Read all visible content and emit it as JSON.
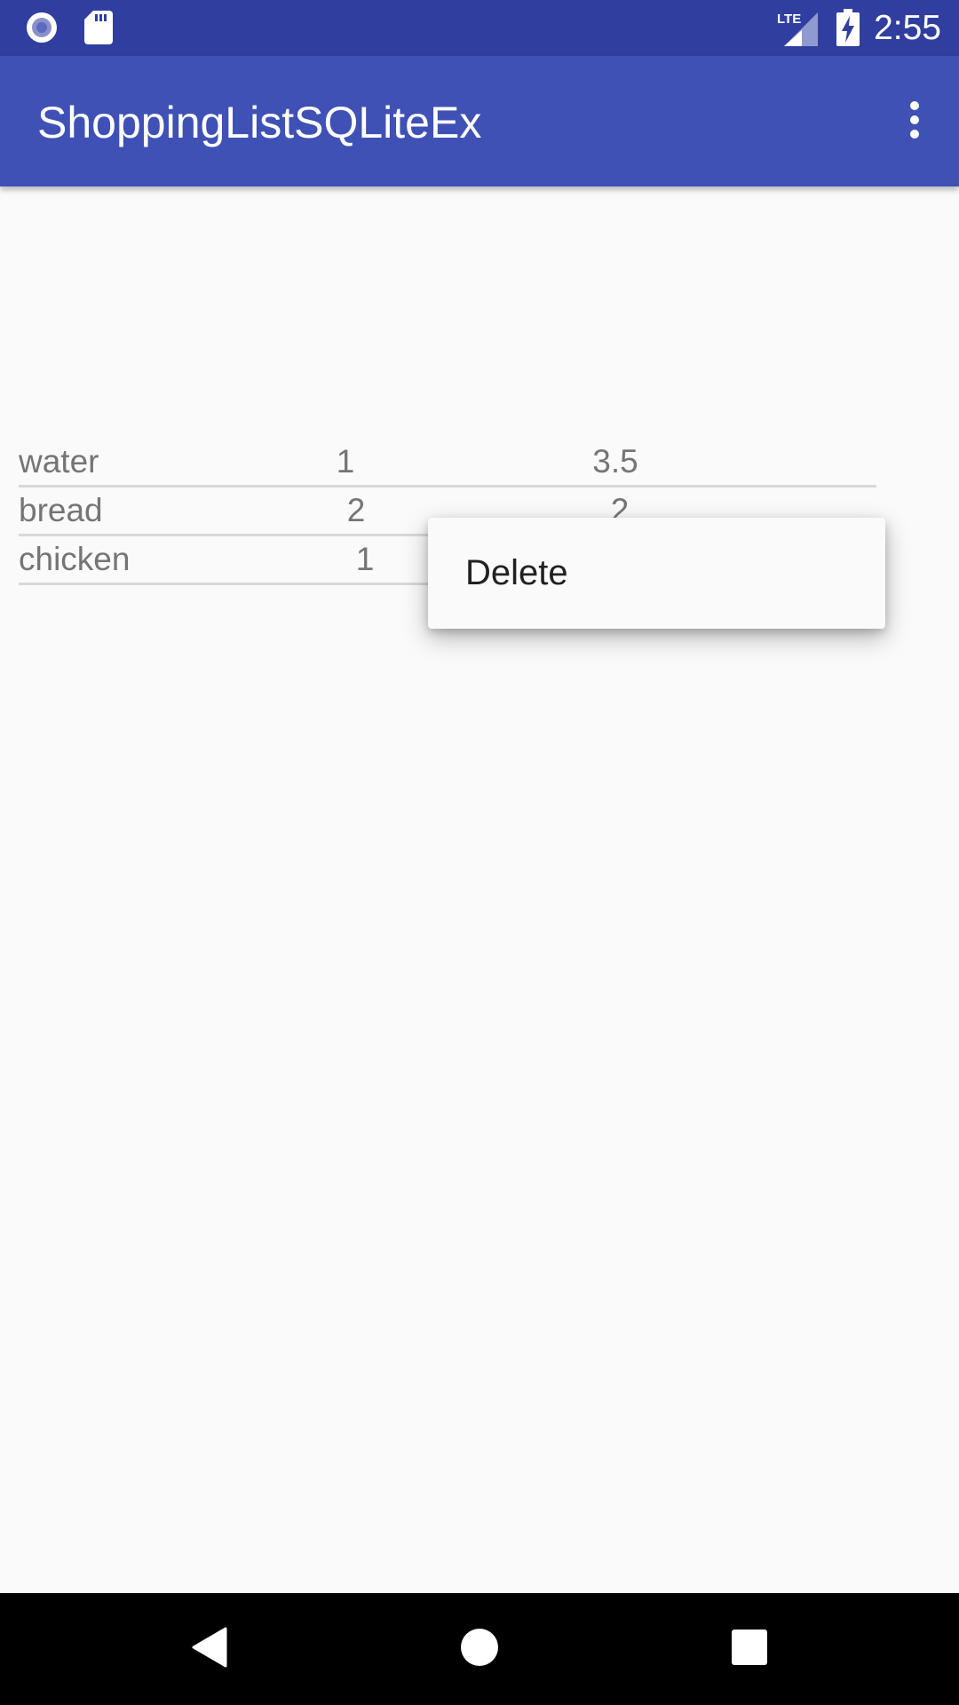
{
  "status_bar": {
    "time": "2:55",
    "network": "LTE",
    "icons": [
      "record-icon",
      "sd-card-icon",
      "lte-signal-icon",
      "battery-charging-icon"
    ]
  },
  "app_bar": {
    "title": "ShoppingListSQLiteEx",
    "overflow_icon": "more-vert-icon"
  },
  "items": [
    {
      "name": "water",
      "qty": "1",
      "price": "3.5"
    },
    {
      "name": "bread",
      "qty": "2",
      "price": "2"
    },
    {
      "name": "chicken",
      "qty": "1",
      "price": ""
    }
  ],
  "context_menu": {
    "items": [
      {
        "label": "Delete"
      }
    ]
  },
  "nav_bar": {
    "icons": [
      "back-icon",
      "home-icon",
      "recents-icon"
    ]
  },
  "colors": {
    "status_bar": "#303f9f",
    "app_bar": "#3f51b5",
    "background": "#fafafa"
  }
}
